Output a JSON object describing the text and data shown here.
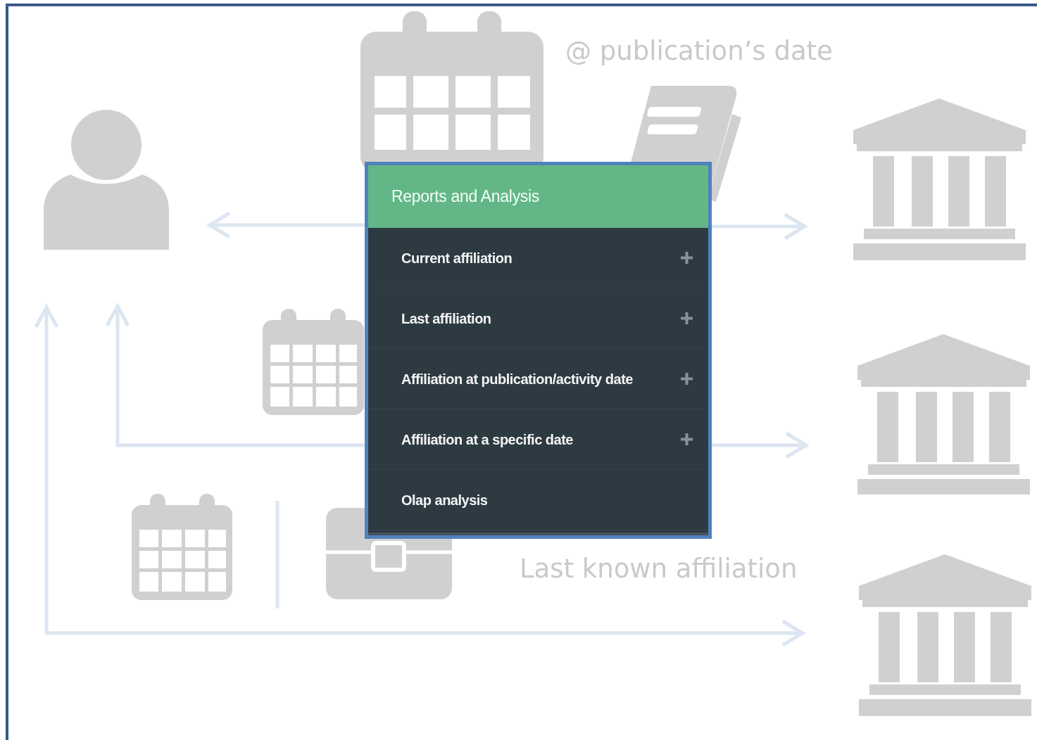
{
  "diagram": {
    "labels": [
      {
        "text": "@ publication’s date",
        "kind": "top"
      },
      {
        "text": "Last known affiliation",
        "kind": "bottom"
      }
    ]
  },
  "menu": {
    "title": "Reports and Analysis",
    "items": [
      {
        "label": "Current affiliation",
        "expandable": true
      },
      {
        "label": "Last affiliation",
        "expandable": true
      },
      {
        "label": "Affiliation at publication/activity date",
        "expandable": true
      },
      {
        "label": "Affiliation at a specific date",
        "expandable": true
      },
      {
        "label": "Olap analysis",
        "expandable": false
      }
    ]
  }
}
